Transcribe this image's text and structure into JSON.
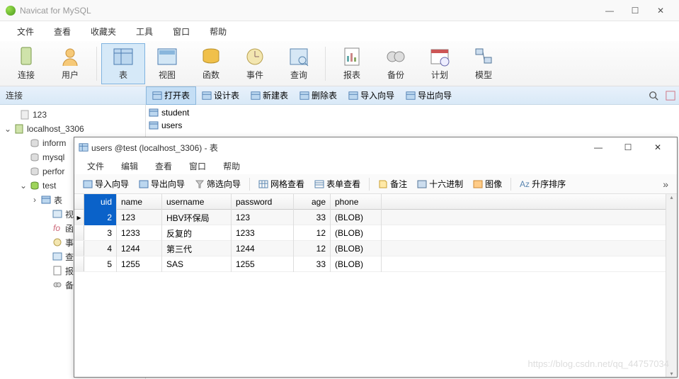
{
  "app": {
    "title": "Navicat for MySQL"
  },
  "menu": [
    "文件",
    "查看",
    "收藏夹",
    "工具",
    "窗口",
    "帮助"
  ],
  "tools": [
    {
      "label": "连接",
      "name": "connect"
    },
    {
      "label": "用户",
      "name": "user"
    },
    {
      "label": "表",
      "name": "table",
      "selected": true
    },
    {
      "label": "视图",
      "name": "view"
    },
    {
      "label": "函数",
      "name": "function"
    },
    {
      "label": "事件",
      "name": "event"
    },
    {
      "label": "查询",
      "name": "query"
    },
    {
      "label": "报表",
      "name": "report"
    },
    {
      "label": "备份",
      "name": "backup"
    },
    {
      "label": "计划",
      "name": "schedule"
    },
    {
      "label": "模型",
      "name": "model"
    }
  ],
  "secbar": {
    "left_label": "连接",
    "buttons": [
      "打开表",
      "设计表",
      "新建表",
      "删除表",
      "导入向导",
      "导出向导"
    ],
    "selected_index": 0
  },
  "tree": {
    "items": [
      {
        "label": "123",
        "depth": 1,
        "icon": "db-off"
      },
      {
        "label": "localhost_3306",
        "depth": 0,
        "icon": "db-on",
        "caret": "down"
      },
      {
        "label": "inform",
        "depth": 2,
        "icon": "schema",
        "cut": true
      },
      {
        "label": "mysql",
        "depth": 2,
        "icon": "schema",
        "cut": true
      },
      {
        "label": "perfor",
        "depth": 2,
        "icon": "schema",
        "cut": true
      },
      {
        "label": "test",
        "depth": 2,
        "icon": "schema-green",
        "caret": "down"
      },
      {
        "label": "表",
        "depth": 3,
        "icon": "tables",
        "caret": "right"
      },
      {
        "label": "视图",
        "depth": 4,
        "icon": "view",
        "cut": true
      },
      {
        "label": "函数",
        "depth": 4,
        "icon": "fx",
        "cut": true
      },
      {
        "label": "事件",
        "depth": 4,
        "icon": "event",
        "cut": true
      },
      {
        "label": "查询",
        "depth": 4,
        "icon": "query",
        "cut": true
      },
      {
        "label": "报表",
        "depth": 4,
        "icon": "report",
        "cut": true
      },
      {
        "label": "备份",
        "depth": 4,
        "icon": "backup",
        "cut": true
      }
    ]
  },
  "tables_list": [
    "student",
    "users"
  ],
  "sub": {
    "title": "users @test (localhost_3306) - 表",
    "menu": [
      "文件",
      "编辑",
      "查看",
      "窗口",
      "帮助"
    ],
    "toolbar": [
      "导入向导",
      "导出向导",
      "筛选向导",
      "网格查看",
      "表单查看",
      "备注",
      "十六进制",
      "图像",
      "升序排序"
    ],
    "columns": [
      "uid",
      "name",
      "username",
      "password",
      "age",
      "phone"
    ],
    "selected_col": 0,
    "selected_row": 0,
    "rows": [
      {
        "uid": "2",
        "name": "123",
        "username": "HBV环保局",
        "password": "123",
        "age": "33",
        "phone": "(BLOB)"
      },
      {
        "uid": "3",
        "name": "1233",
        "username": "反复的",
        "password": "1233",
        "age": "12",
        "phone": "(BLOB)"
      },
      {
        "uid": "4",
        "name": "1244",
        "username": "第三代",
        "password": "1244",
        "age": "12",
        "phone": "(BLOB)"
      },
      {
        "uid": "5",
        "name": "1255",
        "username": "SAS",
        "password": "1255",
        "age": "33",
        "phone": "(BLOB)"
      }
    ]
  },
  "watermark": "https://blog.csdn.net/qq_44757034"
}
